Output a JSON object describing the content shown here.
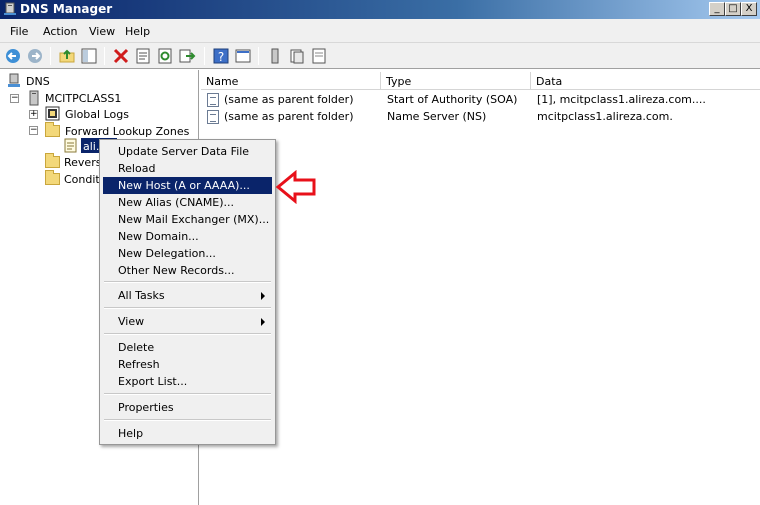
{
  "window": {
    "title": "DNS Manager",
    "buttons": [
      "_",
      "□",
      "X"
    ]
  },
  "menu": [
    "File",
    "Action",
    "View",
    "Help"
  ],
  "toolbar_icons": [
    "back-icon",
    "forward-icon",
    "up-folder-icon",
    "show-hide-tree-icon",
    "delete-icon",
    "properties-icon",
    "refresh-icon",
    "export-icon",
    "help-icon",
    "console-icon",
    "server-icon",
    "records-icon",
    "zone-icon"
  ],
  "tree": {
    "root": "DNS",
    "server": "MCITPCLASS1",
    "global_logs": "Global Logs",
    "forward_zones": "Forward Lookup Zones",
    "zone_selected": "ali.",
    "reverse_zones_partial": "Revers",
    "conditional_partial": "Conditi"
  },
  "list": {
    "columns": [
      "Name",
      "Type",
      "Data"
    ],
    "rows": [
      {
        "name": "(same as parent folder)",
        "type": "Start of Authority (SOA)",
        "data": "[1], mcitpclass1.alireza.com...."
      },
      {
        "name": "(same as parent folder)",
        "type": "Name Server (NS)",
        "data": "mcitpclass1.alireza.com."
      }
    ]
  },
  "context_menu": {
    "group1": [
      "Update Server Data File",
      "Reload",
      "New Host (A or AAAA)...",
      "New Alias (CNAME)...",
      "New Mail Exchanger (MX)...",
      "New Domain...",
      "New Delegation...",
      "Other New Records..."
    ],
    "all_tasks": "All Tasks",
    "view": "View",
    "group4": [
      "Delete",
      "Refresh",
      "Export List..."
    ],
    "properties": "Properties",
    "help": "Help",
    "highlighted": "New Host (A or AAAA)..."
  },
  "colors": {
    "title_bar": "#0a246a",
    "highlight": "#0a246a",
    "annotation_arrow": "#e8101a"
  }
}
